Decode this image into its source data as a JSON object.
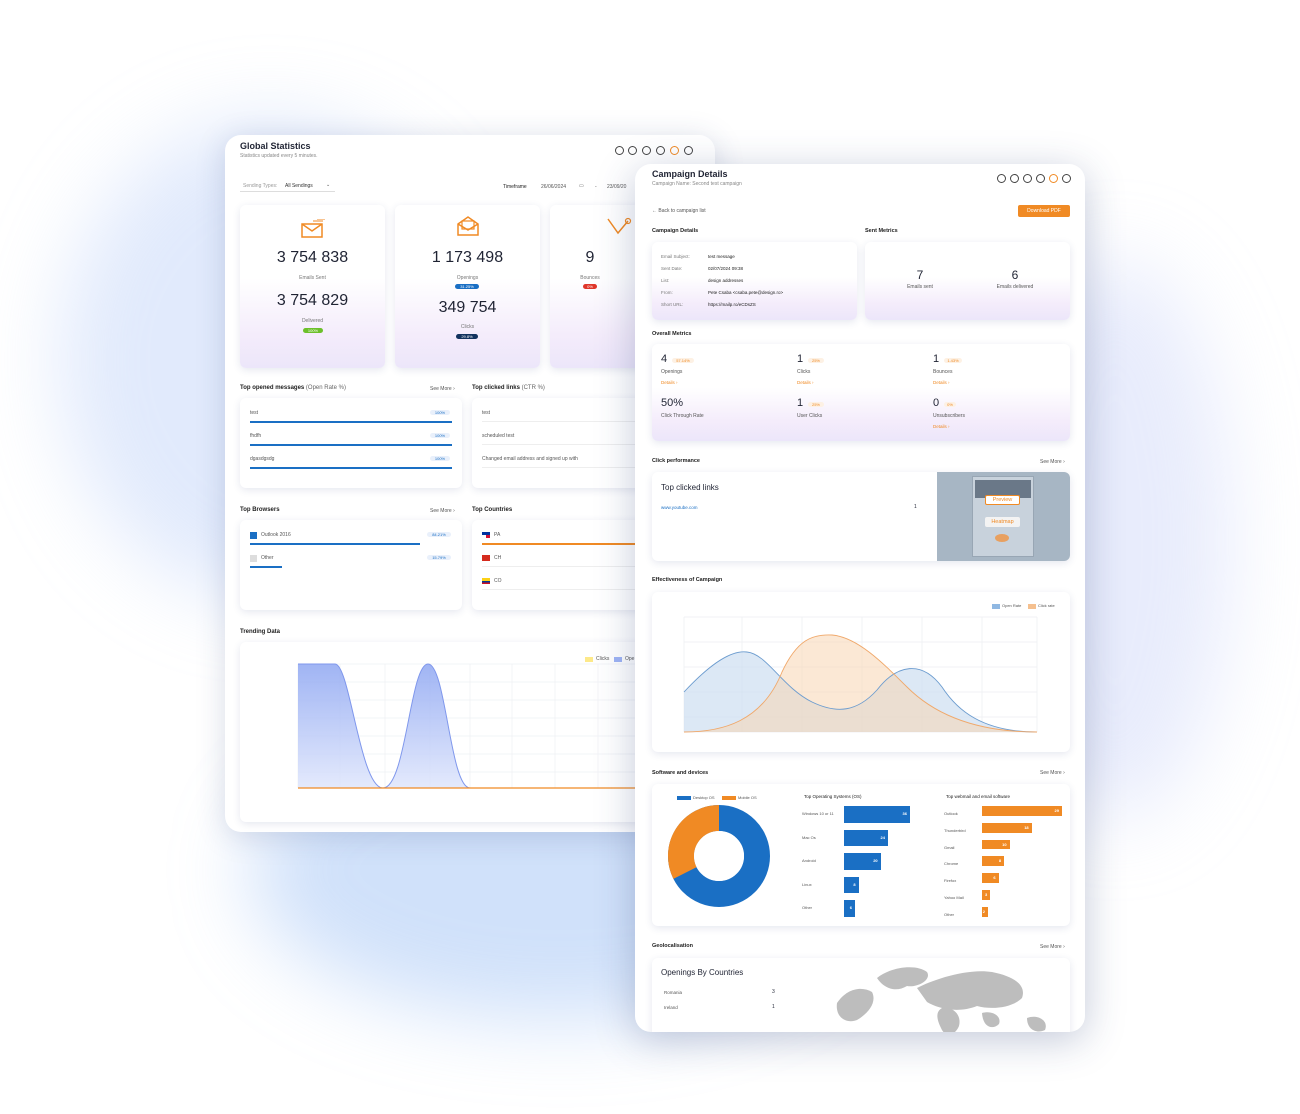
{
  "global_statistics": {
    "title": "Global Statistics",
    "subtitle": "Statistics updated every 5 minutes.",
    "sending_types_label": "Sending Types:",
    "sending_types_value": "All Sendings",
    "timeframe_label": "Timeframe",
    "date_from": "26/06/2024",
    "date_to": "23/09/20",
    "date_separator": "-",
    "stats": {
      "emails_sent_value": "3 754 838",
      "emails_sent_label": "Emails Sent",
      "delivered_value": "3 754 829",
      "delivered_label": "Delivered",
      "delivered_pct": "100%",
      "openings_value": "1 173 498",
      "openings_label": "Openings",
      "openings_pct": "31.25%",
      "clicks_value": "349 754",
      "clicks_label": "Clicks",
      "clicks_pct": "29.8%",
      "bounces_value": "9",
      "bounces_label": "Bounces",
      "bounces_pct": "0%"
    },
    "top_opened_title": "Top opened messages",
    "top_opened_suffix": "(Open Rate %)",
    "see_more": "See More",
    "top_opened": [
      {
        "name": "test",
        "pct": "100%"
      },
      {
        "name": "fhdfh",
        "pct": "100%"
      },
      {
        "name": "dgasdgsdg",
        "pct": "100%"
      }
    ],
    "top_clicked_title": "Top clicked links",
    "top_clicked_suffix": "(CTR %)",
    "top_clicked": [
      "test",
      "scheduled test",
      "Changed email address and signed up with"
    ],
    "top_browsers_title": "Top Browsers",
    "top_browsers": [
      {
        "name": "Outlook 2016",
        "pct": "84.21%",
        "fraction": 0.84
      },
      {
        "name": "Other",
        "pct": "15.79%",
        "fraction": 0.16
      }
    ],
    "top_countries_title": "Top Countries",
    "top_countries": [
      {
        "code": "PA"
      },
      {
        "code": "CH"
      },
      {
        "code": "CO"
      }
    ],
    "trending_title": "Trending Data",
    "trending_legend": [
      "Clicks",
      "Ope"
    ]
  },
  "campaign_details": {
    "title": "Campaign Details",
    "subtitle": "Campaign Name: Second test campaign",
    "back_link": "Back to campaign list",
    "download_button": "Download PDF",
    "details_section": "Campaign Details",
    "sent_metrics_section": "Sent Metrics",
    "details": [
      {
        "label": "Email Subject:",
        "value": "test message"
      },
      {
        "label": "Sent Date:",
        "value": "02/07/2024 09:38"
      },
      {
        "label": "List:",
        "value": "design addresses"
      },
      {
        "label": "From:",
        "value": "Pete Csaba <csaba.pete@design.ro>"
      },
      {
        "label": "Short URL:",
        "value": "https://mailp.ro/eCDsZS"
      }
    ],
    "sent_metrics": [
      {
        "value": "7",
        "label": "Emails sent"
      },
      {
        "value": "6",
        "label": "Emails delivered"
      }
    ],
    "overall_section": "Overall Metrics",
    "overall_metrics": [
      {
        "value": "4",
        "pct": "57.14%",
        "label": "Openings",
        "details": "Details"
      },
      {
        "value": "1",
        "pct": "25%",
        "label": "Clicks",
        "details": "Details"
      },
      {
        "value": "1",
        "pct": "1.43%",
        "label": "Bounces",
        "details": "Details"
      },
      {
        "value": "50%",
        "pct": "",
        "label": "Click Through Rate",
        "details": ""
      },
      {
        "value": "1",
        "pct": "25%",
        "label": "User Clicks",
        "details": ""
      },
      {
        "value": "0",
        "pct": "0%",
        "label": "Unsubscribers",
        "details": "Details"
      }
    ],
    "click_perf_section": "Click performance",
    "see_more": "See More",
    "top_links_title": "Top clicked links",
    "top_link_url": "www.youtube.com",
    "top_link_count": "1",
    "preview_button": "Preview",
    "heatmap_button": "Heatmap",
    "effectiveness_section": "Effectiveness of Campaign",
    "effectiveness_legend": [
      "Open Rate",
      "Click rate"
    ],
    "software_section": "Software and devices",
    "donut_legend": [
      "Desktop OS",
      "Mobile OS"
    ],
    "os_title": "Top Operating Systems (OS)",
    "os_items": [
      {
        "name": "Windows 10 or 11",
        "value": 36
      },
      {
        "name": "Mac Os",
        "value": 24
      },
      {
        "name": "Android",
        "value": 20
      },
      {
        "name": "Linux",
        "value": 8
      },
      {
        "name": "Other",
        "value": 6
      }
    ],
    "webmail_title": "Top webmail and email software",
    "webmail_items": [
      {
        "name": "Outlook",
        "value": 29
      },
      {
        "name": "Thunderbird",
        "value": 18
      },
      {
        "name": "Gmail",
        "value": 10
      },
      {
        "name": "Chrome",
        "value": 8
      },
      {
        "name": "Firefox",
        "value": 6
      },
      {
        "name": "Yahoo Mail",
        "value": 3
      },
      {
        "name": "Other",
        "value": 2
      }
    ],
    "geo_section": "Geolocalisation",
    "geo_title": "Openings By Countries",
    "geo_items": [
      {
        "country": "Romania",
        "count": "3"
      },
      {
        "country": "Ireland",
        "count": "1"
      }
    ]
  },
  "colors": {
    "accent": "#f08a24",
    "blue": "#1a6fc4",
    "green": "#6cc02a",
    "red": "#e0362a",
    "navy": "#12335e"
  }
}
